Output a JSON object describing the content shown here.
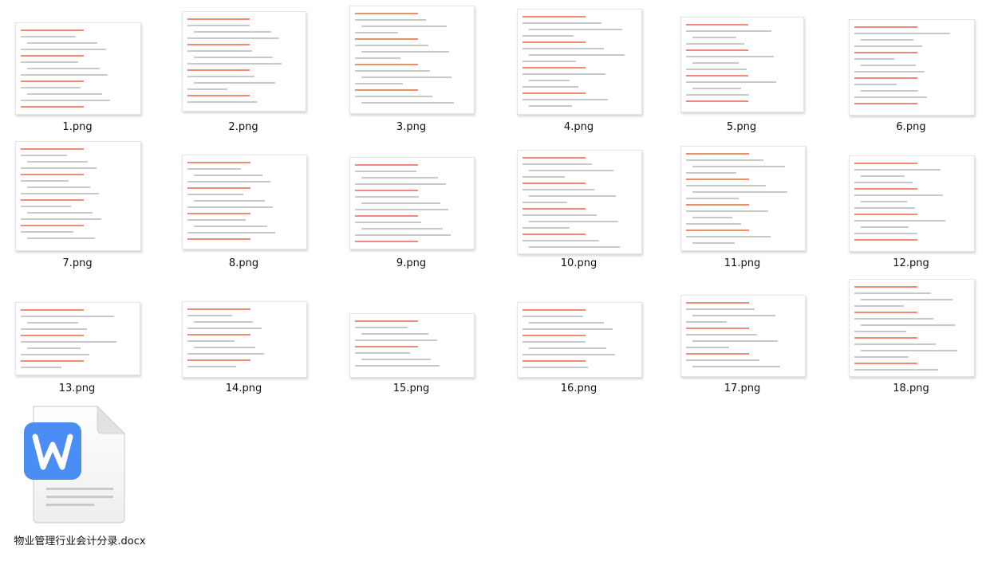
{
  "files": [
    {
      "name": "1.png"
    },
    {
      "name": "2.png"
    },
    {
      "name": "3.png"
    },
    {
      "name": "4.png"
    },
    {
      "name": "5.png"
    },
    {
      "name": "6.png"
    },
    {
      "name": "7.png"
    },
    {
      "name": "8.png"
    },
    {
      "name": "9.png"
    },
    {
      "name": "10.png"
    },
    {
      "name": "11.png"
    },
    {
      "name": "12.png"
    },
    {
      "name": "13.png"
    },
    {
      "name": "14.png"
    },
    {
      "name": "15.png"
    },
    {
      "name": "16.png"
    },
    {
      "name": "17.png"
    },
    {
      "name": "18.png"
    }
  ],
  "document": {
    "name": "物业管理行业会计分录.docx",
    "icon": "word-document-icon",
    "accent": "#4a8ef5"
  }
}
